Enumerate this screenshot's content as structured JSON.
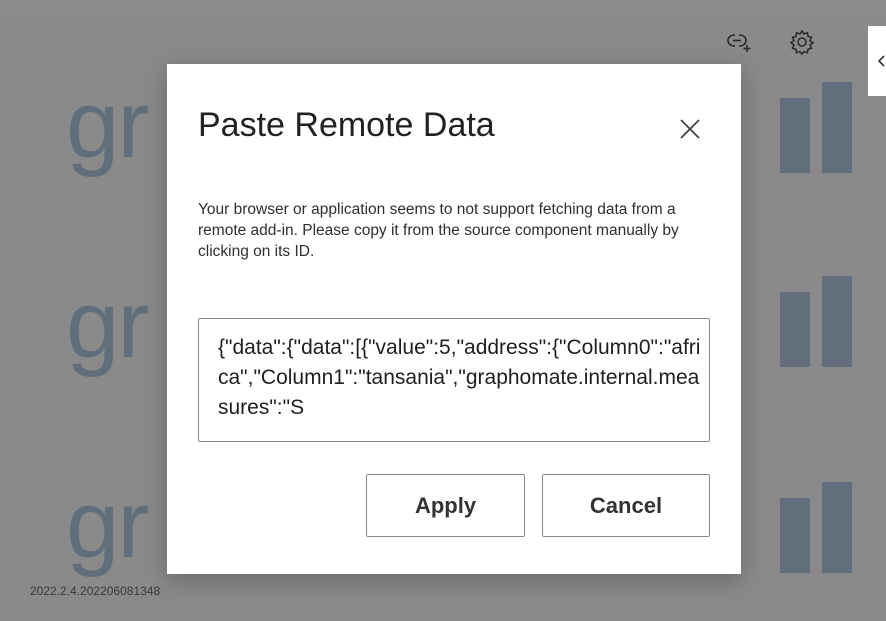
{
  "background": {
    "watermark_text": "gr",
    "version": "2022.2.4.202206081348"
  },
  "toolbar": {
    "icons": [
      "link-icon",
      "gear-icon"
    ],
    "side_tab_icon": "chevron-left-icon"
  },
  "dialog": {
    "title": "Paste Remote Data",
    "close_icon": "close-icon",
    "message": "Your browser or application seems to not support fetching data from a remote add-in. Please copy it from the source component manually by clicking on its ID.",
    "data_value": "{\"data\":{\"data\":[{\"value\":5,\"address\":{\"Column0\":\"africa\",\"Column1\":\"tansania\",\"graphomate.internal.measures\":\"S",
    "apply_label": "Apply",
    "cancel_label": "Cancel"
  },
  "colors": {
    "overlay": "#8c8c8c",
    "brand_blue": "#2b6cb0",
    "dialog_bg": "#ffffff"
  }
}
